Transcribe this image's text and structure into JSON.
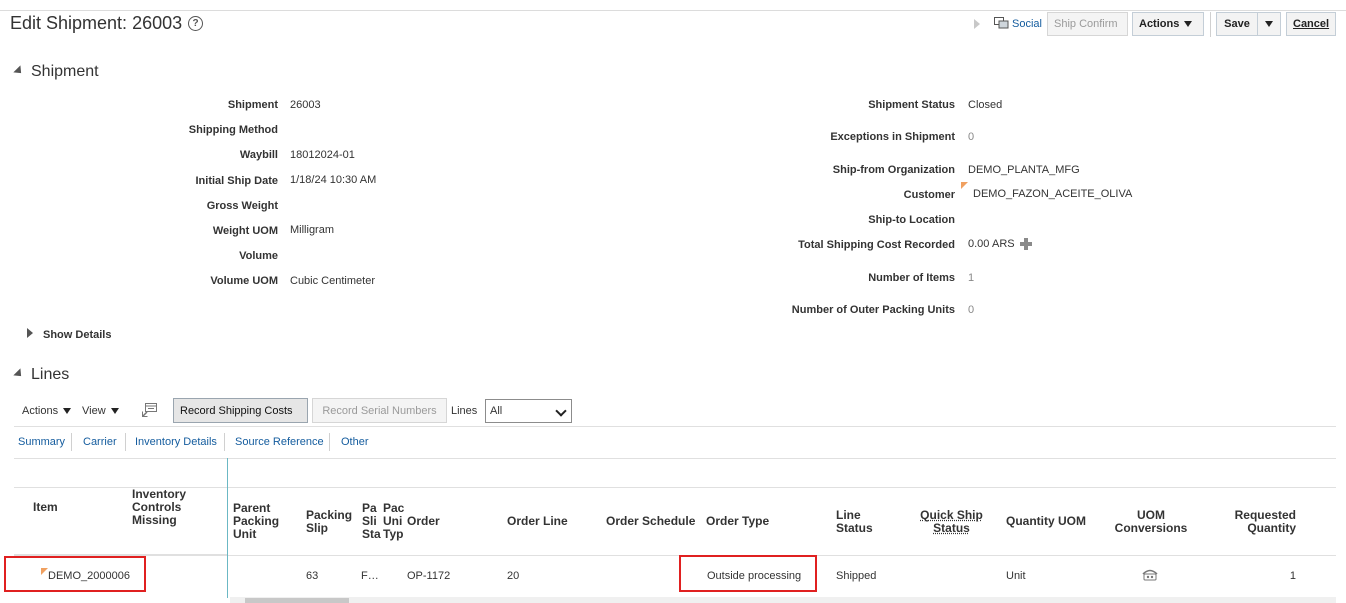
{
  "header": {
    "title": "Edit Shipment: 26003",
    "help_symbol": "?",
    "social_label": "Social",
    "ship_confirm_label": "Ship Confirm",
    "actions_label": "Actions",
    "save_label": "Save",
    "cancel_label": "Cancel"
  },
  "shipment_section": {
    "heading": "Shipment",
    "left_fields": [
      {
        "label": "Shipment",
        "value": "26003"
      },
      {
        "label": "Shipping Method",
        "value": ""
      },
      {
        "label": "Waybill",
        "value": "18012024-01"
      },
      {
        "label": "Initial Ship Date",
        "value": "1/18/24 10:30 AM"
      },
      {
        "label": "Gross Weight",
        "value": ""
      },
      {
        "label": "Weight UOM",
        "value": "Milligram"
      },
      {
        "label": "Volume",
        "value": ""
      },
      {
        "label": "Volume UOM",
        "value": "Cubic Centimeter"
      }
    ],
    "right_fields": [
      {
        "label": "Shipment Status",
        "value": "Closed"
      },
      {
        "label": "Exceptions in Shipment",
        "value": "0"
      },
      {
        "label": "Ship-from Organization",
        "value": "DEMO_PLANTA_MFG"
      },
      {
        "label": "Customer",
        "value": "DEMO_FAZON_ACEITE_OLIVA"
      },
      {
        "label": "Ship-to Location",
        "value": ""
      },
      {
        "label": "Total Shipping Cost Recorded",
        "value": "0.00",
        "currency": "ARS"
      },
      {
        "label": "Number of Items",
        "value": "1"
      },
      {
        "label": "Number of Outer Packing Units",
        "value": "0"
      }
    ],
    "show_details_label": "Show Details"
  },
  "lines_section": {
    "heading": "Lines",
    "toolbar": {
      "actions_label": "Actions",
      "view_label": "View",
      "record_shipping_costs_label": "Record Shipping Costs",
      "record_serial_numbers_label": "Record Serial Numbers",
      "lines_label": "Lines",
      "lines_filter_value": "All"
    },
    "subtabs": [
      "Summary",
      "Carrier",
      "Inventory Details",
      "Source Reference",
      "Other"
    ],
    "columns": {
      "item": "Item",
      "inventory_controls_missing": [
        "Inventory",
        "Controls",
        "Missing"
      ],
      "parent_packing_unit": [
        "Parent",
        "Packing",
        "Unit"
      ],
      "packing_slip": [
        "Packing",
        "Slip"
      ],
      "col_pa": [
        "Pa",
        "Sli",
        "Sta"
      ],
      "col_pac": [
        "Pac",
        "Uni",
        "Typ"
      ],
      "order": "Order",
      "order_line": "Order Line",
      "order_schedule": "Order Schedule",
      "order_type": "Order Type",
      "line_status": [
        "Line",
        "Status"
      ],
      "quick_ship_status": [
        "Quick Ship",
        "Status"
      ],
      "quantity_uom": "Quantity UOM",
      "uom_conversions": [
        "UOM",
        "Conversions"
      ],
      "requested_quantity": [
        "Requested",
        "Quantity"
      ]
    },
    "row": {
      "item": "DEMO_2000006",
      "packing_slip": "63",
      "col_pa": "F…",
      "order": "OP-1172",
      "order_line": "20",
      "order_type": "Outside processing",
      "line_status": "Shipped",
      "quantity_uom": "Unit",
      "requested_quantity": "1"
    }
  },
  "icons": {
    "help": "help-circle-icon",
    "social": "social-chat-icon",
    "detach": "detach-table-icon",
    "uom": "uom-conversion-icon",
    "add": "add-cost-icon"
  },
  "colors": {
    "link": "#145c9e",
    "highlight": "#e02020",
    "flag": "#f0a060"
  }
}
